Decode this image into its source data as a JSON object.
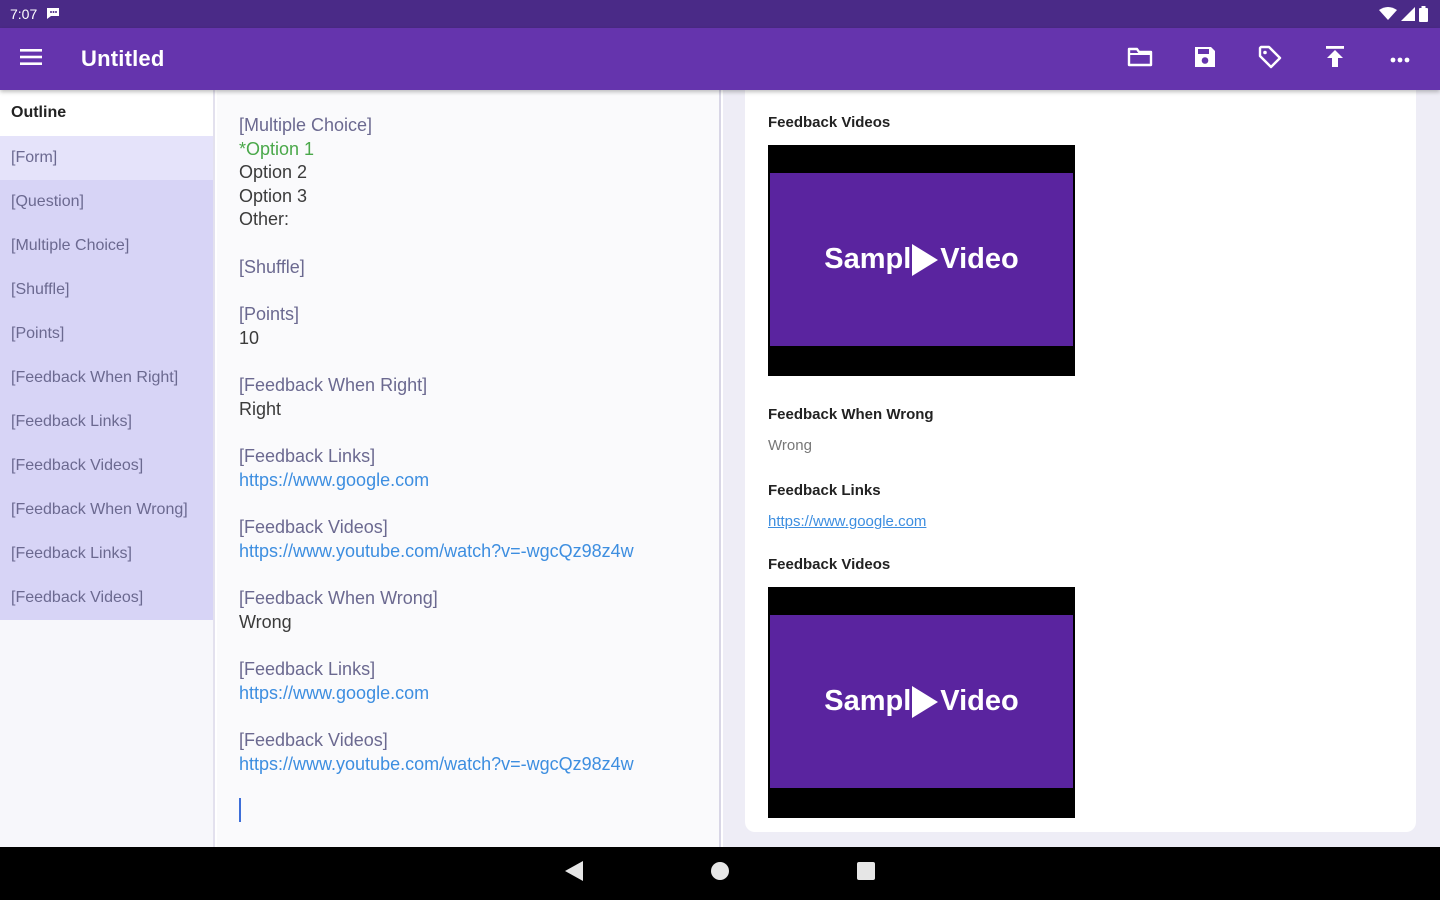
{
  "status": {
    "time": "7:07"
  },
  "toolbar": {
    "title": "Untitled"
  },
  "outline": {
    "heading": "Outline",
    "items": [
      {
        "label": "[Form]"
      },
      {
        "label": "[Question]"
      },
      {
        "label": "[Multiple Choice]"
      },
      {
        "label": "[Shuffle]"
      },
      {
        "label": "[Points]"
      },
      {
        "label": "[Feedback When Right]"
      },
      {
        "label": "[Feedback Links]"
      },
      {
        "label": "[Feedback Videos]"
      },
      {
        "label": "[Feedback When Wrong]"
      },
      {
        "label": "[Feedback Links]"
      },
      {
        "label": "[Feedback Videos]"
      }
    ]
  },
  "editor": {
    "mc_tag": "[Multiple Choice]",
    "option1": "*Option 1",
    "option2": "Option 2",
    "option3": "Option 3",
    "other": "Other:",
    "shuffle_tag": "[Shuffle]",
    "points_tag": "[Points]",
    "points_value": "10",
    "fwr_tag": "[Feedback When Right]",
    "fwr_value": "Right",
    "links_tag_1": "[Feedback Links]",
    "link_1": "https://www.google.com",
    "videos_tag_1": "[Feedback Videos]",
    "video_url_1": "https://www.youtube.com/watch?v=-wgcQz98z4w",
    "fww_tag": "[Feedback When Wrong]",
    "fww_value": "Wrong",
    "links_tag_2": "[Feedback Links]",
    "link_2": "https://www.google.com",
    "videos_tag_2": "[Feedback Videos]",
    "video_url_2": "https://www.youtube.com/watch?v=-wgcQz98z4w"
  },
  "preview": {
    "videos_heading_1": "Feedback Videos",
    "video_1": {
      "text_left": "Sampl",
      "text_right": "Video"
    },
    "fww_heading": "Feedback When Wrong",
    "fww_text": "Wrong",
    "links_heading": "Feedback Links",
    "link": "https://www.google.com",
    "videos_heading_2": "Feedback Videos",
    "video_2": {
      "text_left": "Sampl",
      "text_right": "Video"
    }
  },
  "colors": {
    "status_bar": "#4a2a87",
    "toolbar": "#6534ad",
    "outline_highlight": "#d7d4f6",
    "link": "#3d8ee0",
    "correct_option": "#4aa84a",
    "video_bg": "#5a249f"
  },
  "icons": {
    "toolbar": [
      "menu-icon",
      "folder-icon",
      "save-icon",
      "tag-icon",
      "upload-icon",
      "more-icon"
    ],
    "nav": [
      "back-icon",
      "home-icon",
      "recents-icon"
    ]
  }
}
